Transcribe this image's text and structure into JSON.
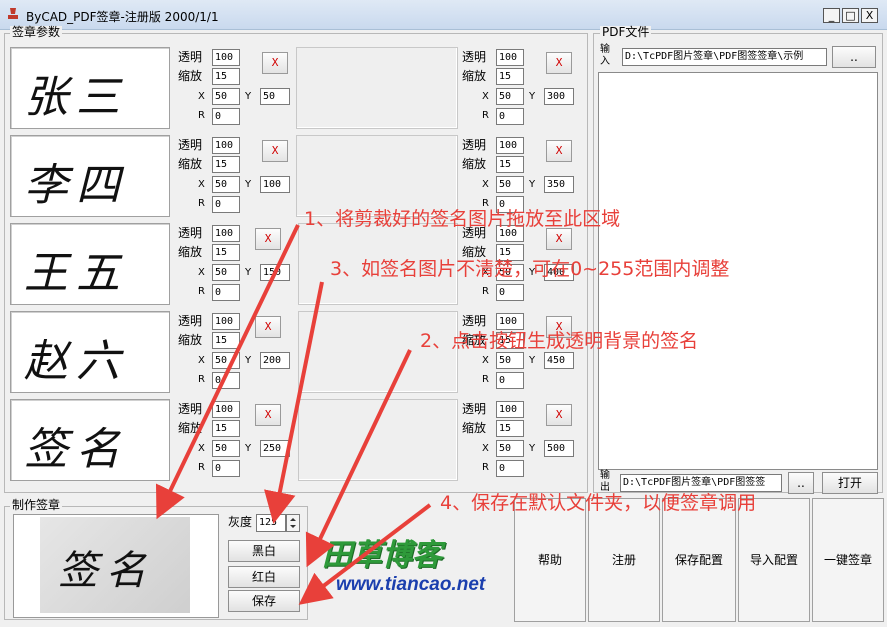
{
  "window": {
    "title": "ByCAD_PDF签章-注册版 2000/1/1",
    "minimize": "_",
    "maximize": "□",
    "close": "X"
  },
  "params_group": {
    "label": "签章参数"
  },
  "field_labels": {
    "alpha": "透明",
    "scale": "缩放",
    "x": "X",
    "y": "Y",
    "r": "R",
    "clear": "X"
  },
  "left_slots": [
    {
      "signature": "张三",
      "alpha": "100",
      "scale": "15",
      "x": "50",
      "y": "50",
      "r": "0"
    },
    {
      "signature": "李四",
      "alpha": "100",
      "scale": "15",
      "x": "50",
      "y": "100",
      "r": "0"
    },
    {
      "signature": "王五",
      "alpha": "100",
      "scale": "15",
      "x": "50",
      "y": "150",
      "r": "0"
    },
    {
      "signature": "赵六",
      "alpha": "100",
      "scale": "15",
      "x": "50",
      "y": "200",
      "r": "0"
    },
    {
      "signature": "签名",
      "alpha": "100",
      "scale": "15",
      "x": "50",
      "y": "250",
      "r": "0"
    }
  ],
  "right_slots": [
    {
      "alpha": "100",
      "scale": "15",
      "x": "50",
      "y": "300",
      "r": "0"
    },
    {
      "alpha": "100",
      "scale": "15",
      "x": "50",
      "y": "350",
      "r": "0"
    },
    {
      "alpha": "100",
      "scale": "15",
      "x": "50",
      "y": "400",
      "r": "0"
    },
    {
      "alpha": "100",
      "scale": "15",
      "x": "50",
      "y": "450",
      "r": "0"
    },
    {
      "alpha": "100",
      "scale": "15",
      "x": "50",
      "y": "500",
      "r": "0"
    }
  ],
  "pdf_group": {
    "label": "PDF文件",
    "input_label": "输入",
    "input_path": "D:\\TcPDF图片签章\\PDF图签签章\\示例",
    "input_browse": "..",
    "output_label": "输出",
    "output_path": "D:\\TcPDF图片签章\\PDF图签签",
    "output_browse": "..",
    "open_button": "打开"
  },
  "make_group": {
    "label": "制作签章",
    "preview_signature": "签名",
    "gray_label": "灰度",
    "gray_value": "125",
    "black_white": "黑白",
    "red_white": "红白",
    "save": "保存"
  },
  "brand": {
    "name": "田草博客",
    "url": "www.tiancao.net"
  },
  "bottom_buttons": {
    "help": "帮助",
    "register": "注册",
    "save_config": "保存配置",
    "import_config": "导入配置",
    "one_click": "一键签章"
  },
  "annotations": {
    "a1": "1、将剪裁好的签名图片拖放至此区域",
    "a3": "3、如签名图片不清楚，可在0~255范围内调整",
    "a2": "2、点击按钮生成透明背景的签名",
    "a4": "4、保存在默认文件夹，以便签章调用"
  },
  "colors": {
    "annotation": "#e8403a",
    "clear_x": "#d00000",
    "brand_green": "#2e9a3a"
  }
}
